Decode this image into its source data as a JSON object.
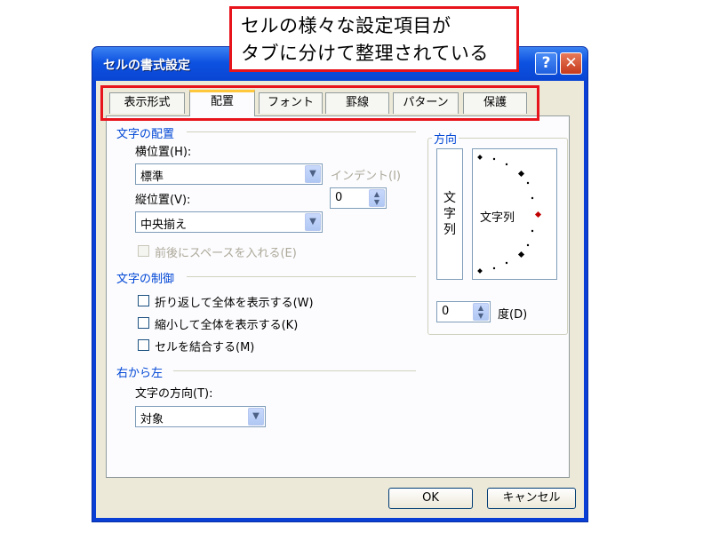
{
  "callout": {
    "line1": "セルの様々な設定項目が",
    "line2": "タブに分けて整理されている"
  },
  "window": {
    "title": "セルの書式設定",
    "help_glyph": "?",
    "close_glyph": "✕"
  },
  "tabs": [
    {
      "label": "表示形式",
      "active": false
    },
    {
      "label": "配置",
      "active": true
    },
    {
      "label": "フォント",
      "active": false
    },
    {
      "label": "罫線",
      "active": false
    },
    {
      "label": "パターン",
      "active": false
    },
    {
      "label": "保護",
      "active": false
    }
  ],
  "alignment": {
    "group_label": "文字の配置",
    "horizontal_label": "横位置(H):",
    "horizontal_value": "標準",
    "indent_label": "インデント(I)",
    "indent_value": "0",
    "vertical_label": "縦位置(V):",
    "vertical_value": "中央揃え",
    "distributed_label": "前後にスペースを入れる(E)"
  },
  "text_control": {
    "group_label": "文字の制御",
    "wrap_label": "折り返して全体を表示する(W)",
    "shrink_label": "縮小して全体を表示する(K)",
    "merge_label": "セルを結合する(M)"
  },
  "rtl": {
    "group_label": "右から左",
    "direction_label": "文字の方向(T):",
    "direction_value": "対象"
  },
  "orientation": {
    "group_label": "方向",
    "vertical_chars": [
      "文",
      "字",
      "列"
    ],
    "dial_text": "文字列",
    "degree_value": "0",
    "degree_label": "度(D)"
  },
  "buttons": {
    "ok": "OK",
    "cancel": "キャンセル"
  },
  "colors": {
    "title_bar": "#0a45d3",
    "highlight_red": "#e8141c",
    "group_blue": "#0046d5",
    "dialog_bg": "#ece9d8"
  }
}
